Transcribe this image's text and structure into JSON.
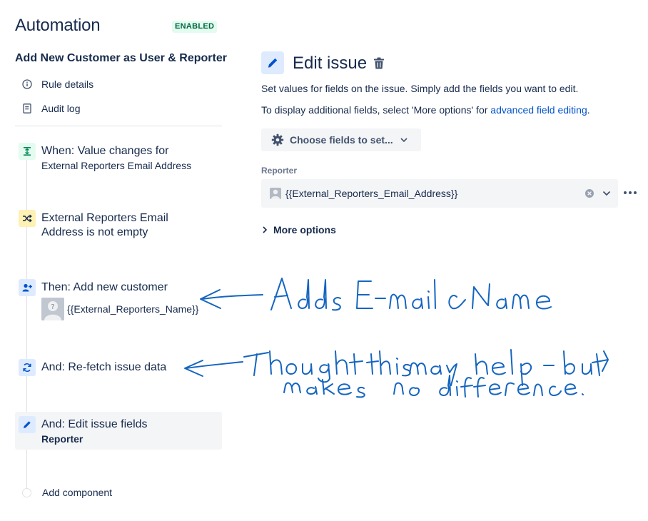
{
  "app": {
    "title": "Automation",
    "status_badge": "ENABLED"
  },
  "rule": {
    "name": "Add New Customer as User & Reporter"
  },
  "sidebar": {
    "links": [
      {
        "label": "Rule details",
        "icon": "info-icon"
      },
      {
        "label": "Audit log",
        "icon": "document-icon"
      }
    ]
  },
  "flow": {
    "trigger": {
      "title": "When: Value changes for",
      "subtitle": "External Reporters Email Address",
      "icon": "trigger-icon"
    },
    "condition": {
      "title_line1": "External Reporters Email",
      "title_line2": "Address is not empty",
      "icon": "shuffle-icon"
    },
    "action_add_customer": {
      "title": "Then: Add new customer",
      "value": "{{External_Reporters_Name}}",
      "icon": "add-user-icon"
    },
    "action_refetch": {
      "title": "And: Re-fetch issue data",
      "icon": "refresh-icon"
    },
    "action_edit": {
      "title": "And: Edit issue fields",
      "subtitle": "Reporter",
      "icon": "pencil-icon"
    },
    "add_component": {
      "label": "Add component"
    }
  },
  "panel": {
    "title": "Edit issue",
    "description_1": "Set values for fields on the issue. Simply add the fields you want to edit.",
    "description_2_prefix": "To display additional fields, select 'More options' for ",
    "description_2_link": "advanced field editing",
    "description_2_suffix": ".",
    "choose_fields_button": "Choose fields to set...",
    "reporter_label": "Reporter",
    "reporter_value": "{{External_Reporters_Email_Address}}",
    "more_options": "More options"
  },
  "colors": {
    "trigger_bg": "#e3fcef",
    "trigger_fg": "#00875a",
    "condition_bg": "#fff0b3",
    "condition_fg": "#172b4d",
    "action_bg": "#deebff",
    "action_fg": "#0052cc",
    "annotation_ink": "#1565c0"
  }
}
